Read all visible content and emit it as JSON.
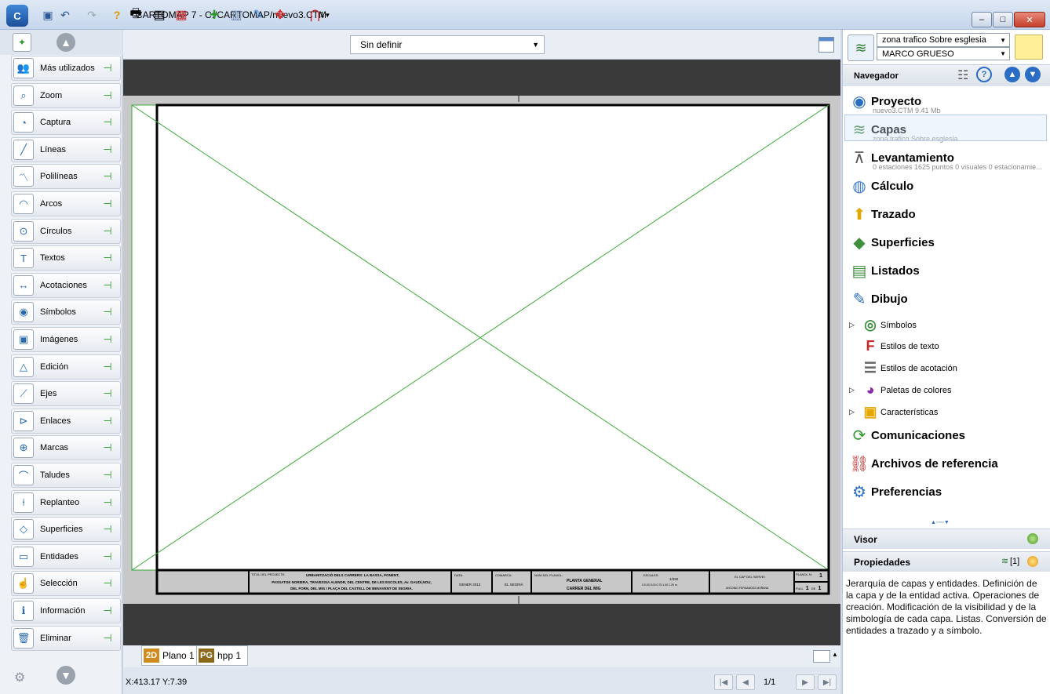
{
  "window": {
    "title": "CARTOMAP 7 - C:/CARTOMAP/nuevo3.CTM",
    "minimize": "–",
    "maximize": "□",
    "close": "✕"
  },
  "left_panel": {
    "items": [
      {
        "label": "Más utilizados",
        "icon": "people-icon"
      },
      {
        "label": "Zoom",
        "icon": "magnifier-icon"
      },
      {
        "label": "Captura",
        "icon": "capture-icon"
      },
      {
        "label": "Líneas",
        "icon": "line-icon"
      },
      {
        "label": "Polilíneas",
        "icon": "polyline-icon"
      },
      {
        "label": "Arcos",
        "icon": "arc-icon"
      },
      {
        "label": "Círculos",
        "icon": "circle-icon"
      },
      {
        "label": "Textos",
        "icon": "text-icon"
      },
      {
        "label": "Acotaciones",
        "icon": "dimension-icon"
      },
      {
        "label": "Símbolos",
        "icon": "symbol-icon"
      },
      {
        "label": "Imágenes",
        "icon": "image-icon"
      },
      {
        "label": "Edición",
        "icon": "edit-icon"
      },
      {
        "label": "Ejes",
        "icon": "axis-icon"
      },
      {
        "label": "Enlaces",
        "icon": "link-icon"
      },
      {
        "label": "Marcas",
        "icon": "crosshair-icon"
      },
      {
        "label": "Taludes",
        "icon": "slope-icon"
      },
      {
        "label": "Replanteo",
        "icon": "stakeout-icon"
      },
      {
        "label": "Superficies",
        "icon": "surface-icon"
      },
      {
        "label": "Entidades",
        "icon": "entity-icon"
      },
      {
        "label": "Selección",
        "icon": "selection-icon"
      },
      {
        "label": "Información",
        "icon": "info-icon"
      },
      {
        "label": "Eliminar",
        "icon": "trash-icon"
      }
    ]
  },
  "toolbar": {
    "style_combo": "Sin definir",
    "magnet_label": "1"
  },
  "titleblock": {
    "project_label": "TITOL DEL PROJECTE:",
    "project_lines": [
      "URBANITZACIÓ DELS CARRERS: LA BASSA, PONENT,",
      "PASSATGE NORIERA, TRAVESSIA ALENDR, DEL CENTRE, DE LES ESCOLES, Av. GAUDÍ,NOU,",
      "DEL FORN, DEL MIG I PLAÇA DEL CASTELL DE BENAVENT DE SEGRIÀ."
    ],
    "date_label": "DATA:",
    "date_value": "GENER 2013",
    "county_label": "COMARCA:",
    "county_value": "EL SEGRIÀ",
    "plan_label": "NOM DEL PLANOL:",
    "plan_lines": [
      "PLANTA GENERAL",
      "CARRER DEL MIG"
    ],
    "scale_label": "ESCALES:",
    "scale_value": "1/250",
    "scale_bar": "0   5.00   5.00   0.75   1.00   1.25 m.",
    "author_label": "EL CAP DEL SERVEI:",
    "author_value": "ANTONIO FERNANDEZ MUÑANA",
    "plan_no_label": "PLANOL N:",
    "plan_no_value": "1",
    "sheet_label": "FULL",
    "sheet_value": "1",
    "sheet_of": "DE",
    "sheet_total": "1"
  },
  "tabs": [
    {
      "badge": "2D",
      "label": "Plano 1",
      "color": "#d08a1e"
    },
    {
      "badge": "PG",
      "label": "hpp 1",
      "color": "#8a6a1a"
    }
  ],
  "status": {
    "coords": "X:413.17 Y:7.39",
    "page": "1/1"
  },
  "right_panel": {
    "layer_combo": "zona trafico Sobre esglesia",
    "user_combo": "MARCO GRUESO",
    "navigator_title": "Navegador",
    "sections": [
      {
        "label": "Proyecto",
        "sub": "nuevo3.CTM 9.41 Mb",
        "icon": "project-icon"
      },
      {
        "label": "Capas",
        "sub": "zona trafico Sobre esglesia",
        "icon": "layers-icon"
      },
      {
        "label": "Levantamiento",
        "sub": "0 estaciones 1625 puntos 0 visuales 0 estacionamie...",
        "icon": "survey-icon"
      },
      {
        "label": "Cálculo",
        "sub": "",
        "icon": "calculation-icon"
      },
      {
        "label": "Trazado",
        "sub": "",
        "icon": "road-sign-icon"
      },
      {
        "label": "Superficies",
        "sub": "",
        "icon": "surface-icon"
      },
      {
        "label": "Listados",
        "sub": "",
        "icon": "list-icon"
      },
      {
        "label": "Dibujo",
        "sub": "",
        "icon": "drawing-icon"
      }
    ],
    "drawing_children": [
      {
        "label": "Símbolos",
        "expander": true,
        "icon": "symbol-icon"
      },
      {
        "label": "Estilos de texto",
        "expander": false,
        "icon": "text-style-icon"
      },
      {
        "label": "Estilos de acotación",
        "expander": false,
        "icon": "dimension-style-icon"
      },
      {
        "label": "Paletas de colores",
        "expander": true,
        "icon": "palette-icon"
      },
      {
        "label": "Características",
        "expander": true,
        "icon": "features-icon"
      }
    ],
    "sections2": [
      {
        "label": "Comunicaciones",
        "icon": "communications-icon"
      },
      {
        "label": "Archivos de referencia",
        "icon": "reference-files-icon"
      },
      {
        "label": "Preferencias",
        "icon": "preferences-icon"
      }
    ],
    "viewer_label": "Visor",
    "properties_label": "Propiedades",
    "properties_count": "[1]",
    "description": "Jerarquía de capas y entidades. Definición de la capa y de la entidad activa. Operaciones de creación. Modificación de la visibilidad y de la simbología de cada capa. Listas. Conversión de entidades a trazado y a símbolo."
  }
}
